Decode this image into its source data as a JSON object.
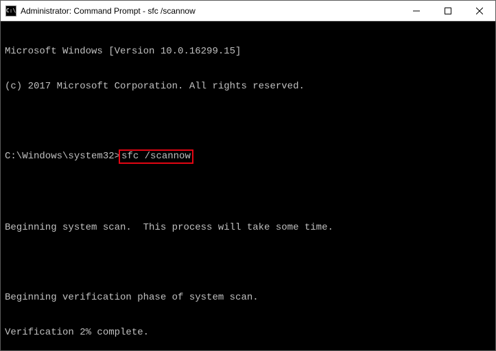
{
  "window": {
    "title": "Administrator: Command Prompt - sfc  /scannow",
    "icon_label": "C:\\"
  },
  "console": {
    "line1": "Microsoft Windows [Version 10.0.16299.15]",
    "line2": "(c) 2017 Microsoft Corporation. All rights reserved.",
    "prompt": "C:\\Windows\\system32>",
    "command": "sfc /scannow",
    "msg1": "Beginning system scan.  This process will take some time.",
    "msg2": "Beginning verification phase of system scan.",
    "msg3": "Verification 2% complete."
  }
}
